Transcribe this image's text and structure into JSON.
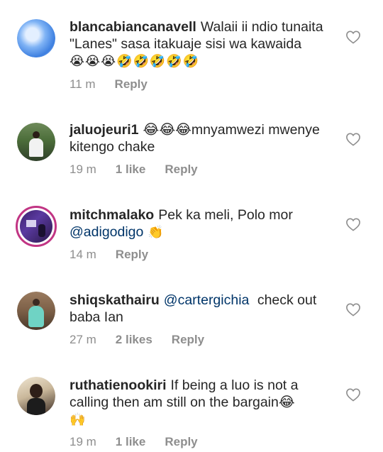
{
  "comments": [
    {
      "username": "blancabiancanavell",
      "text": "Walaii ii ndio tunaita \"Lanes\" sasa itakuaje sisi wa kawaida",
      "emoji": "😭😭😭🤣🤣🤣🤣🤣",
      "time": "11 m",
      "likes": "",
      "reply": "Reply",
      "avatar": "blue-abstract"
    },
    {
      "username": "jaluojeuri1",
      "text": "😂😂😂mnyamwezi mwenye kitengo chake",
      "time": "19 m",
      "likes": "1 like",
      "reply": "Reply",
      "avatar": "man-outdoors"
    },
    {
      "username": "mitchmalako",
      "text": "Pek ka meli, Polo mor",
      "mention": "@adigodigo",
      "emoji": "👏",
      "time": "14 m",
      "likes": "",
      "reply": "Reply",
      "avatar": "purple-room",
      "has_story": true
    },
    {
      "username": "shiqskathairu",
      "mention": "@cartergichia",
      "text": "check out baba Ian",
      "time": "27 m",
      "likes": "2 likes",
      "reply": "Reply",
      "avatar": "woman-teal-dress"
    },
    {
      "username": "ruthatienookiri",
      "text": "If being a luo is not a calling then am still on the bargain😂",
      "emoji": "🙌",
      "time": "19 m",
      "likes": "1 like",
      "reply": "Reply",
      "avatar": "woman-portrait"
    }
  ],
  "icons": {
    "like": "heart-outline-icon"
  },
  "colors": {
    "text": "#262626",
    "meta": "#8e8e8e",
    "mention": "#003569",
    "story_ring": "#c13584"
  }
}
